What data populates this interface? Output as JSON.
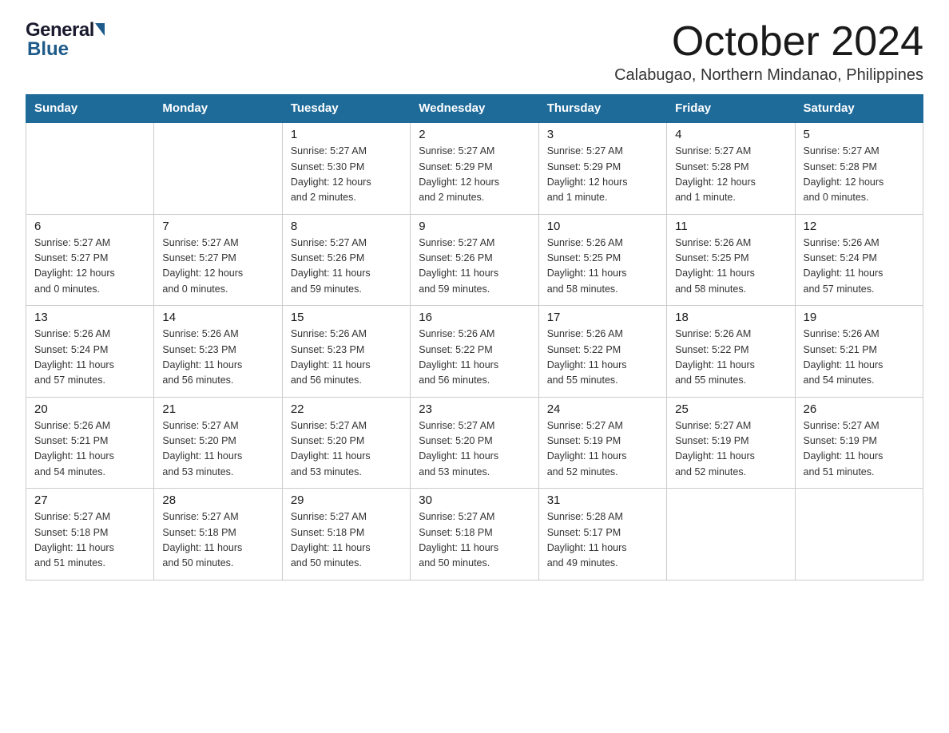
{
  "header": {
    "logo_general": "General",
    "logo_blue": "Blue",
    "month_title": "October 2024",
    "location": "Calabugao, Northern Mindanao, Philippines"
  },
  "days_of_week": [
    "Sunday",
    "Monday",
    "Tuesday",
    "Wednesday",
    "Thursday",
    "Friday",
    "Saturday"
  ],
  "weeks": [
    [
      {
        "day": "",
        "info": ""
      },
      {
        "day": "",
        "info": ""
      },
      {
        "day": "1",
        "info": "Sunrise: 5:27 AM\nSunset: 5:30 PM\nDaylight: 12 hours\nand 2 minutes."
      },
      {
        "day": "2",
        "info": "Sunrise: 5:27 AM\nSunset: 5:29 PM\nDaylight: 12 hours\nand 2 minutes."
      },
      {
        "day": "3",
        "info": "Sunrise: 5:27 AM\nSunset: 5:29 PM\nDaylight: 12 hours\nand 1 minute."
      },
      {
        "day": "4",
        "info": "Sunrise: 5:27 AM\nSunset: 5:28 PM\nDaylight: 12 hours\nand 1 minute."
      },
      {
        "day": "5",
        "info": "Sunrise: 5:27 AM\nSunset: 5:28 PM\nDaylight: 12 hours\nand 0 minutes."
      }
    ],
    [
      {
        "day": "6",
        "info": "Sunrise: 5:27 AM\nSunset: 5:27 PM\nDaylight: 12 hours\nand 0 minutes."
      },
      {
        "day": "7",
        "info": "Sunrise: 5:27 AM\nSunset: 5:27 PM\nDaylight: 12 hours\nand 0 minutes."
      },
      {
        "day": "8",
        "info": "Sunrise: 5:27 AM\nSunset: 5:26 PM\nDaylight: 11 hours\nand 59 minutes."
      },
      {
        "day": "9",
        "info": "Sunrise: 5:27 AM\nSunset: 5:26 PM\nDaylight: 11 hours\nand 59 minutes."
      },
      {
        "day": "10",
        "info": "Sunrise: 5:26 AM\nSunset: 5:25 PM\nDaylight: 11 hours\nand 58 minutes."
      },
      {
        "day": "11",
        "info": "Sunrise: 5:26 AM\nSunset: 5:25 PM\nDaylight: 11 hours\nand 58 minutes."
      },
      {
        "day": "12",
        "info": "Sunrise: 5:26 AM\nSunset: 5:24 PM\nDaylight: 11 hours\nand 57 minutes."
      }
    ],
    [
      {
        "day": "13",
        "info": "Sunrise: 5:26 AM\nSunset: 5:24 PM\nDaylight: 11 hours\nand 57 minutes."
      },
      {
        "day": "14",
        "info": "Sunrise: 5:26 AM\nSunset: 5:23 PM\nDaylight: 11 hours\nand 56 minutes."
      },
      {
        "day": "15",
        "info": "Sunrise: 5:26 AM\nSunset: 5:23 PM\nDaylight: 11 hours\nand 56 minutes."
      },
      {
        "day": "16",
        "info": "Sunrise: 5:26 AM\nSunset: 5:22 PM\nDaylight: 11 hours\nand 56 minutes."
      },
      {
        "day": "17",
        "info": "Sunrise: 5:26 AM\nSunset: 5:22 PM\nDaylight: 11 hours\nand 55 minutes."
      },
      {
        "day": "18",
        "info": "Sunrise: 5:26 AM\nSunset: 5:22 PM\nDaylight: 11 hours\nand 55 minutes."
      },
      {
        "day": "19",
        "info": "Sunrise: 5:26 AM\nSunset: 5:21 PM\nDaylight: 11 hours\nand 54 minutes."
      }
    ],
    [
      {
        "day": "20",
        "info": "Sunrise: 5:26 AM\nSunset: 5:21 PM\nDaylight: 11 hours\nand 54 minutes."
      },
      {
        "day": "21",
        "info": "Sunrise: 5:27 AM\nSunset: 5:20 PM\nDaylight: 11 hours\nand 53 minutes."
      },
      {
        "day": "22",
        "info": "Sunrise: 5:27 AM\nSunset: 5:20 PM\nDaylight: 11 hours\nand 53 minutes."
      },
      {
        "day": "23",
        "info": "Sunrise: 5:27 AM\nSunset: 5:20 PM\nDaylight: 11 hours\nand 53 minutes."
      },
      {
        "day": "24",
        "info": "Sunrise: 5:27 AM\nSunset: 5:19 PM\nDaylight: 11 hours\nand 52 minutes."
      },
      {
        "day": "25",
        "info": "Sunrise: 5:27 AM\nSunset: 5:19 PM\nDaylight: 11 hours\nand 52 minutes."
      },
      {
        "day": "26",
        "info": "Sunrise: 5:27 AM\nSunset: 5:19 PM\nDaylight: 11 hours\nand 51 minutes."
      }
    ],
    [
      {
        "day": "27",
        "info": "Sunrise: 5:27 AM\nSunset: 5:18 PM\nDaylight: 11 hours\nand 51 minutes."
      },
      {
        "day": "28",
        "info": "Sunrise: 5:27 AM\nSunset: 5:18 PM\nDaylight: 11 hours\nand 50 minutes."
      },
      {
        "day": "29",
        "info": "Sunrise: 5:27 AM\nSunset: 5:18 PM\nDaylight: 11 hours\nand 50 minutes."
      },
      {
        "day": "30",
        "info": "Sunrise: 5:27 AM\nSunset: 5:18 PM\nDaylight: 11 hours\nand 50 minutes."
      },
      {
        "day": "31",
        "info": "Sunrise: 5:28 AM\nSunset: 5:17 PM\nDaylight: 11 hours\nand 49 minutes."
      },
      {
        "day": "",
        "info": ""
      },
      {
        "day": "",
        "info": ""
      }
    ]
  ]
}
